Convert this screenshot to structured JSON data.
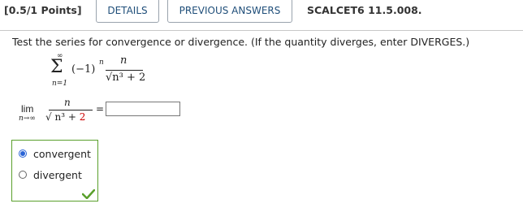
{
  "header": {
    "points": "[0.5/1 Points]",
    "details_label": "DETAILS",
    "previous_answers_label": "PREVIOUS ANSWERS",
    "course_code": "SCALCET6 11.5.008."
  },
  "question": {
    "prompt": "Test the series for convergence or divergence. (If the quantity diverges, enter DIVERGES.)"
  },
  "series": {
    "upper": "∞",
    "sigma": "Σ",
    "lower": "n=1",
    "sign": "(−1)",
    "exponent": "n",
    "numerator": "n",
    "denominator": "√n³ + 2"
  },
  "limit": {
    "lim": "lim",
    "subscript": "n→∞",
    "numerator": "n",
    "denominator_main": "√ n³ + ",
    "denominator_const": "2",
    "equals": "=",
    "answer_value": "",
    "answer_placeholder": ""
  },
  "choices": {
    "options": [
      {
        "label": "convergent",
        "selected": true
      },
      {
        "label": "divergent",
        "selected": false
      }
    ],
    "status_icon": "checkmark-icon",
    "status_color": "#5aa02c"
  },
  "colors": {
    "link": "#1f4e79",
    "correct_border": "#5aa02c",
    "radio_selected": "#2a64d6",
    "highlight_red": "#cc0000"
  }
}
